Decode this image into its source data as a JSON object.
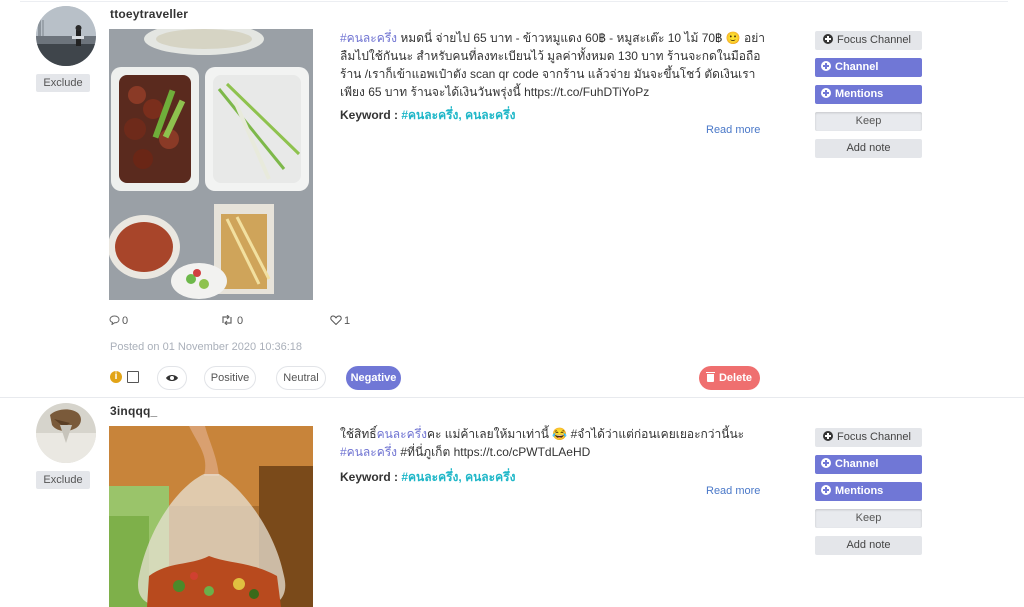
{
  "posts": [
    {
      "username": "ttoeytraveller",
      "exclude": "Exclude",
      "text_parts": [
        {
          "t": "#คนละครึ่ง",
          "hl": true
        },
        {
          "t": " หมดนี่ จ่ายไป 65 บาท - ข้าวหมูแดง 60฿ - หมูสะเต๊ะ 10 ไม้ 70฿ 🙂 อย่าลืมไปใช้กันนะ สำหรับคนที่ลงทะเบียนไว้ มูลค่าทั้งหมด 130 บาท ร้านจะกดในมือถือร้าน /เราก็เข้าแอพเป๋าตัง scan qr code จากร้าน แล้วจ่าย มันจะขึ้นโชว์ ตัดเงินเรา เพียง 65 บาท ร้านจะได้เงินวันพรุ่งนี้ https://t.co/FuhDTiYoPz",
          "hl": false
        }
      ],
      "keyword_label": "Keyword :",
      "keyword_value": "#คนละครึ่ง, คนละครึ่ง",
      "read_more": "Read more",
      "comments": "0",
      "retweets": "0",
      "likes": "1",
      "posted": "Posted on 01 November 2020 10:36:18",
      "sentiment": {
        "positive": "Positive",
        "neutral": "Neutral",
        "negative": "Negative",
        "selected": "Negative"
      },
      "delete": "Delete",
      "buttons": {
        "focus": "Focus Channel",
        "channel": "Channel",
        "mentions": "Mentions",
        "keep": "Keep",
        "note": "Add note"
      }
    },
    {
      "username": "3inqqq_",
      "exclude": "Exclude",
      "text_parts": [
        {
          "t": "ใช้สิทธิ์",
          "hl": false
        },
        {
          "t": "คนละครึ่ง",
          "hl": true
        },
        {
          "t": "คะ แม่ค้าเลยให้มาเท่านี้ 😂 #จำได้ว่าแต่ก่อนเคยเยอะกว่านี้นะ ",
          "hl": false
        },
        {
          "t": "#คนละครึ่ง",
          "hl": true
        },
        {
          "t": " #ที่นี่ภูเก็ต https://t.co/cPWTdLAeHD",
          "hl": false
        }
      ],
      "keyword_label": "Keyword :",
      "keyword_value": "#คนละครึ่ง, คนละครึ่ง",
      "read_more": "Read more",
      "buttons": {
        "focus": "Focus Channel",
        "channel": "Channel",
        "mentions": "Mentions",
        "keep": "Keep",
        "note": "Add note"
      }
    }
  ],
  "icons": {
    "comment": "comment-icon",
    "retweet": "retweet-icon",
    "like": "heart-icon",
    "info": "info-icon",
    "eye": "eye-icon",
    "trash": "trash-icon",
    "focus": "plus-circle-icon"
  },
  "colors": {
    "accent": "#7077d6",
    "hashtag": "#6f73d2",
    "keyword": "#1fb7c8",
    "delete": "#ef6f6f",
    "warning": "#e2a417"
  }
}
